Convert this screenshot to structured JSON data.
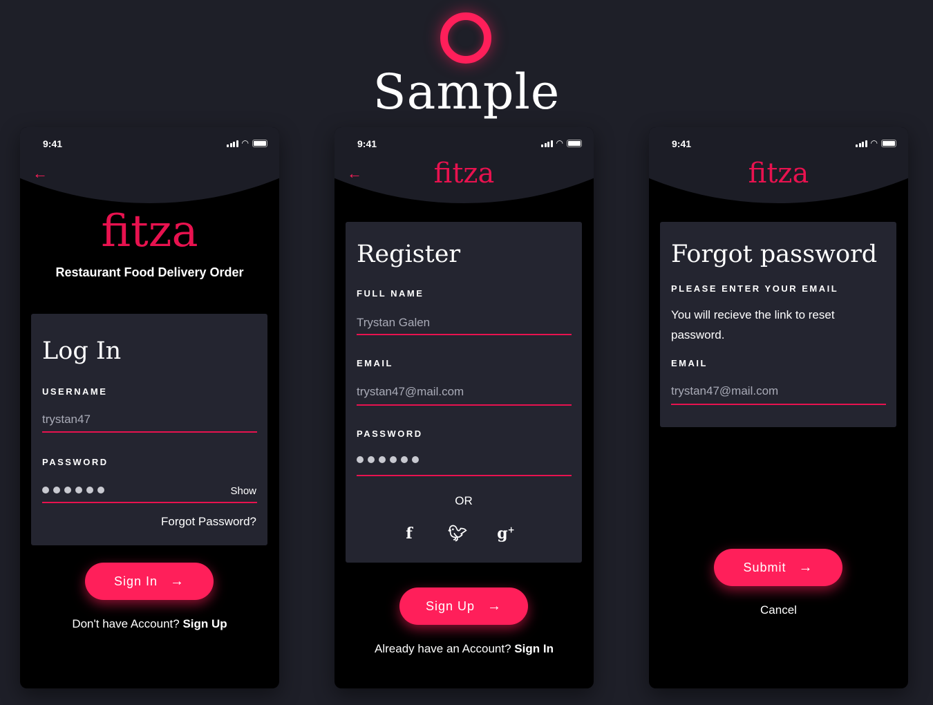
{
  "header": {
    "title": "Sample",
    "logo_icon": "ring-icon"
  },
  "status_bar": {
    "time": "9:41"
  },
  "colors": {
    "accent": "#ff1f5a",
    "background": "#1e1f28",
    "card": "#242530",
    "phone_bg": "#000000"
  },
  "login": {
    "logo": "fitza",
    "subtitle": "Restaurant Food Delivery Order",
    "title": "Log In",
    "username_label": "USERNAME",
    "username_value": "trystan47",
    "password_label": "PASSWORD",
    "password_mask": "••••••",
    "show_label": "Show",
    "forgot_label": "Forgot Password?",
    "button_label": "Sign In",
    "footer_text": "Don't have Account?",
    "footer_link": "Sign Up"
  },
  "register": {
    "logo": "fitza",
    "title": "Register",
    "fullname_label": "FULL NAME",
    "fullname_value": "Trystan Galen",
    "email_label": "EMAIL",
    "email_value": "trystan47@mail.com",
    "password_label": "PASSWORD",
    "password_mask": "••••••",
    "or_label": "OR",
    "social": [
      "facebook-icon",
      "twitter-icon",
      "google-plus-icon"
    ],
    "button_label": "Sign Up",
    "footer_text": "Already have an Account?",
    "footer_link": "Sign In"
  },
  "forgot": {
    "logo": "fitza",
    "title": "Forgot password",
    "subtitle_label": "PLEASE ENTER YOUR EMAIL",
    "note": "You will recieve the link to reset password.",
    "email_label": "EMAIL",
    "email_value": "trystan47@mail.com",
    "button_label": "Submit",
    "cancel_label": "Cancel"
  }
}
